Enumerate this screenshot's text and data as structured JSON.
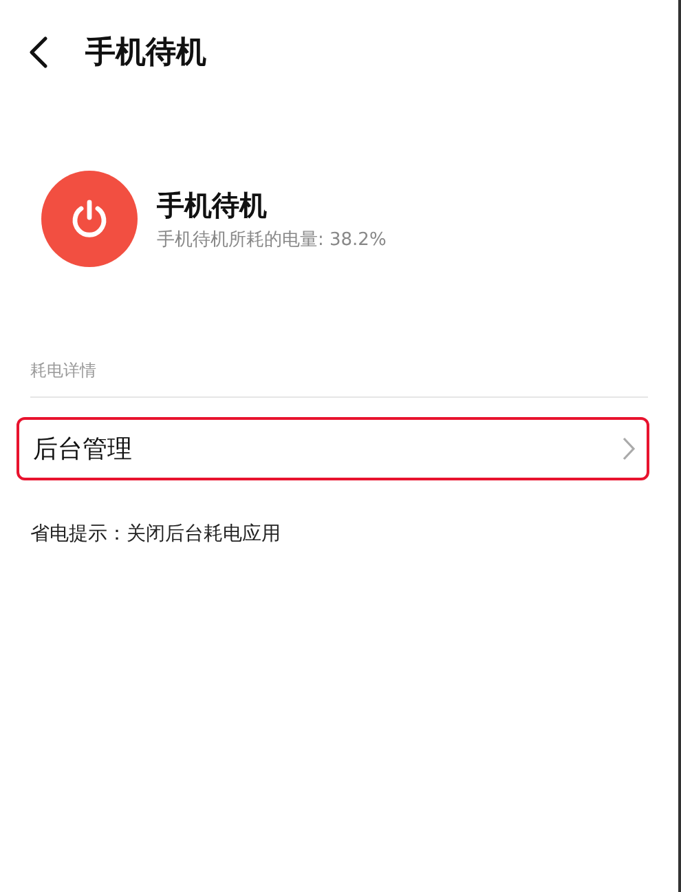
{
  "header": {
    "title": "手机待机"
  },
  "summary": {
    "title": "手机待机",
    "subtitle": "手机待机所耗的电量: 38.2%"
  },
  "section": {
    "label": "耗电详情"
  },
  "rows": [
    {
      "label": "后台管理",
      "highlighted": true
    }
  ],
  "tip": "省电提示：关闭后台耗电应用"
}
